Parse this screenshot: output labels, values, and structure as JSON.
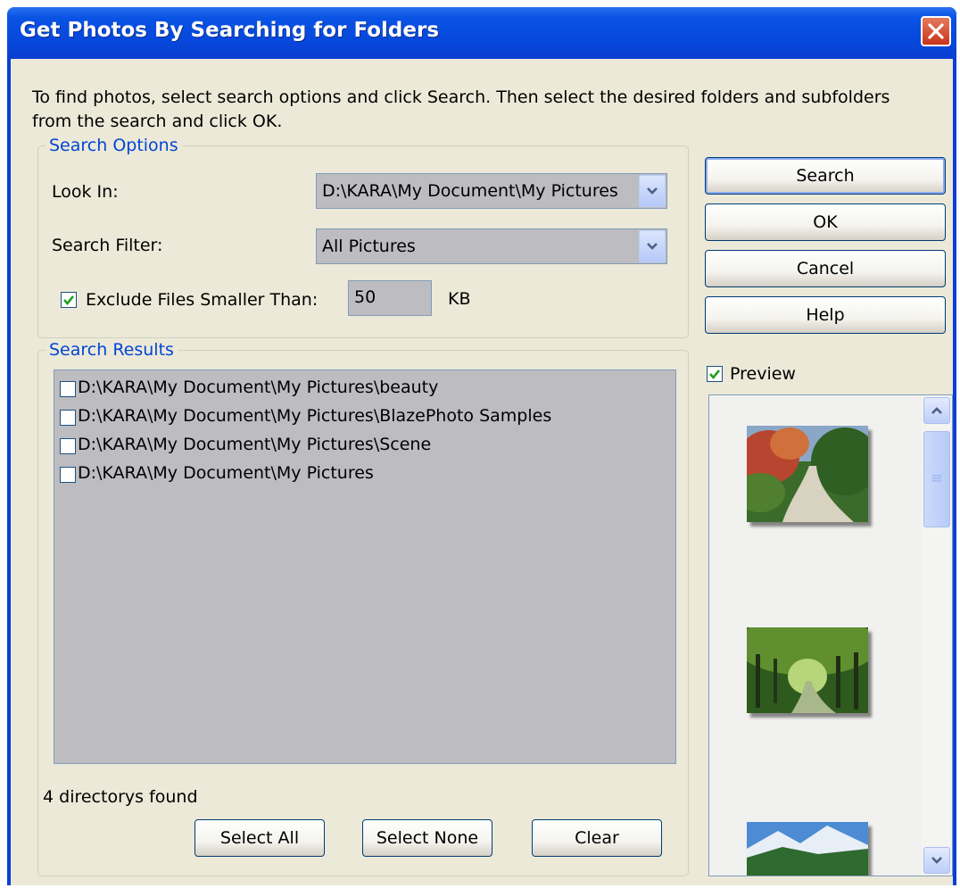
{
  "window": {
    "title": "Get Photos By Searching for Folders",
    "close_icon": "close-icon"
  },
  "instructions": "To find photos, select search options and click Search. Then select the desired folders and subfolders from the search and click  OK.",
  "search_options": {
    "legend": "Search Options",
    "look_in_label": "Look In:",
    "look_in_value": "D:\\KARA\\My Document\\My Pictures",
    "filter_label": "Search Filter:",
    "filter_value": "All Pictures",
    "exclude_label": "Exclude Files Smaller Than:",
    "exclude_checked": true,
    "size_value": "50",
    "size_unit": "KB"
  },
  "buttons": {
    "search": "Search",
    "ok": "OK",
    "cancel": "Cancel",
    "help": "Help"
  },
  "search_results": {
    "legend": "Search Results",
    "items": [
      {
        "path": "D:\\KARA\\My Document\\My Pictures\\beauty",
        "checked": false
      },
      {
        "path": "D:\\KARA\\My Document\\My Pictures\\BlazePhoto Samples",
        "checked": false
      },
      {
        "path": "D:\\KARA\\My Document\\My Pictures\\Scene",
        "checked": false
      },
      {
        "path": "D:\\KARA\\My Document\\My Pictures",
        "checked": false
      }
    ],
    "status": "4 directorys found",
    "select_all": "Select All",
    "select_none": "Select None",
    "clear": "Clear"
  },
  "preview": {
    "label": "Preview",
    "checked": true
  }
}
